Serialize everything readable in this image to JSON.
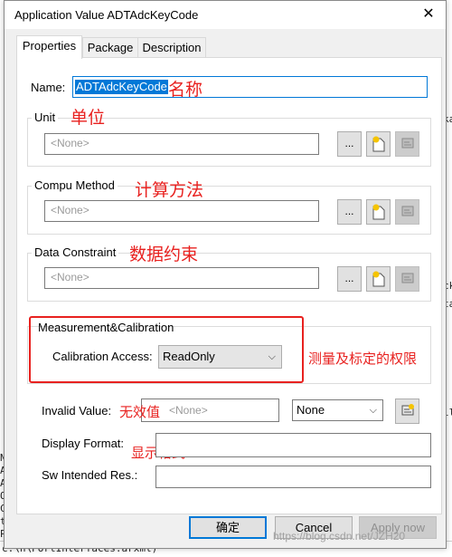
{
  "window": {
    "title": "Application Value ADTAdcKeyCode",
    "close_glyph": "✕"
  },
  "tabs": [
    {
      "label": "Properties",
      "active": true
    },
    {
      "label": "Package",
      "active": false
    },
    {
      "label": "Description",
      "active": false
    }
  ],
  "name": {
    "label": "Name:",
    "value": "ADTAdcKeyCode",
    "annotation": "名称"
  },
  "unit": {
    "label": "Unit",
    "placeholder": "<None>",
    "annotation": "单位"
  },
  "compu_method": {
    "label": "Compu Method",
    "placeholder": "<None>",
    "annotation": "计算方法"
  },
  "data_constraint": {
    "label": "Data Constraint",
    "placeholder": "<None>",
    "annotation": "数据约束"
  },
  "measurement": {
    "label": "Measurement&Calibration",
    "calibration_access_label": "Calibration Access:",
    "calibration_access_value": "ReadOnly",
    "annotation": "测量及标定的权限"
  },
  "invalid_value": {
    "label": "Invalid Value:",
    "placeholder": "<None>",
    "select_value": "None",
    "annotation": "无效值"
  },
  "display_format": {
    "label": "Display Format:",
    "value": "",
    "annotation": "显示格式"
  },
  "sw_intended_res": {
    "label": "Sw Intended Res.:",
    "value": ""
  },
  "buttons": {
    "ok": "确定",
    "cancel": "Cancel",
    "apply": "Apply now",
    "ellipsis": "..."
  },
  "watermark": "https://blog.csdn.net/JZH20",
  "background": {
    "left_fragments": [
      "N",
      "AR",
      "AR",
      "OV",
      "C",
      "t\\",
      "P",
      "c:\\"
    ],
    "bottom_text": "c:\\h\\PortInterfaces.arxml)",
    "right_fragments": [
      "ka",
      "ck",
      "ta",
      "ll"
    ]
  },
  "colors": {
    "accent": "#0078d7",
    "annotation": "#e8211f"
  },
  "icons": [
    "close-icon",
    "new-document-icon",
    "edit-properties-icon",
    "chevron-down-icon"
  ]
}
